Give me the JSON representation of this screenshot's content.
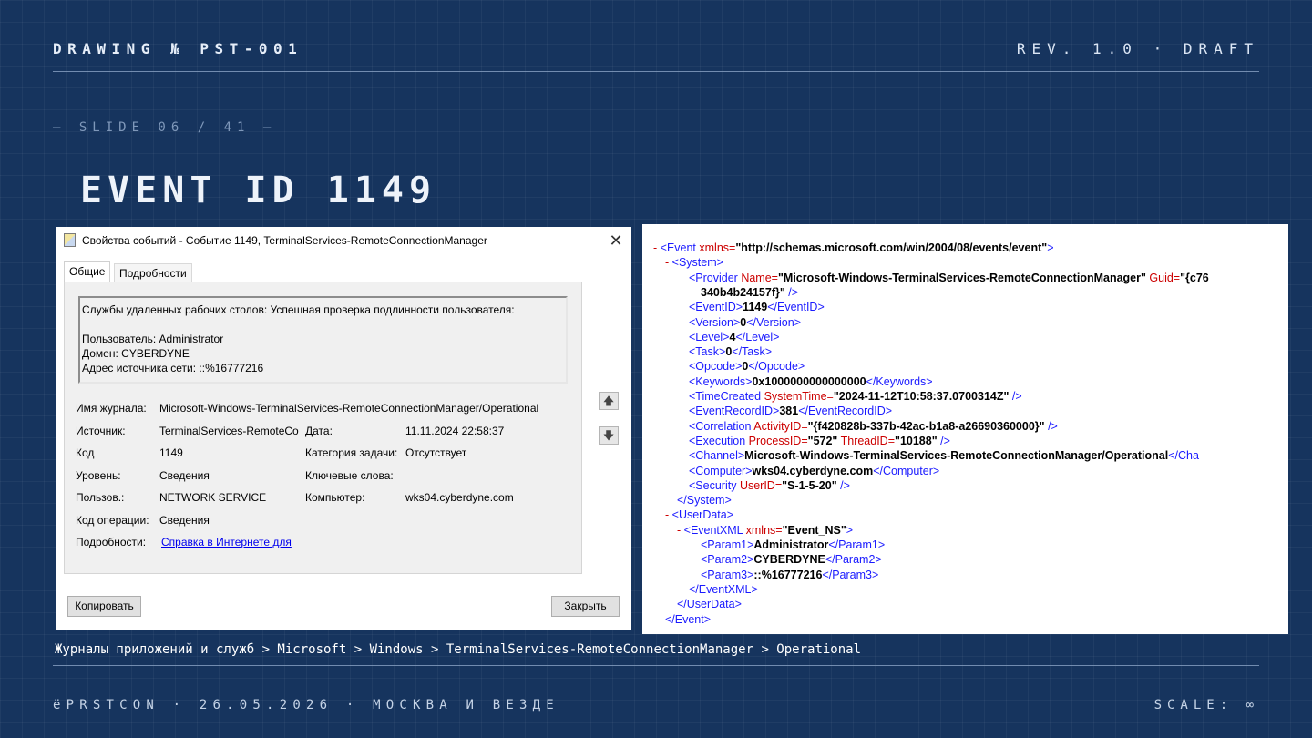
{
  "header": {
    "drawing": "DRAWING № PST-001",
    "revision": "REV. 1.0 · DRAFT"
  },
  "slide_number": "— SLIDE 06 / 41 —",
  "title": "EVENT ID 1149",
  "dialog": {
    "title": "Свойства событий - Событие 1149, TerminalServices-RemoteConnectionManager",
    "close": "✕",
    "tabs": [
      "Общие",
      "Подробности"
    ],
    "description": [
      "Службы удаленных рабочих столов: Успешная проверка подлинности пользователя:",
      "",
      "Пользователь: Administrator",
      "Домен: CYBERDYNE",
      "Адрес источника сети: ::%16777216"
    ],
    "fields": {
      "log_name_label": "Имя журнала:",
      "log_name_value": "Microsoft-Windows-TerminalServices-RemoteConnectionManager/Operational",
      "source_label": "Источник:",
      "source_value": "TerminalServices-RemoteCo",
      "date_label": "Дата:",
      "date_value": "11.11.2024 22:58:37",
      "code_label": "Код",
      "code_value": "1149",
      "task_label": "Категория задачи:",
      "task_value": "Отсутствует",
      "level_label": "Уровень:",
      "level_value": "Сведения",
      "keywords_label": "Ключевые слова:",
      "keywords_value": "",
      "user_label": "Пользов.:",
      "user_value": "NETWORK SERVICE",
      "computer_label": "Компьютер:",
      "computer_value": "wks04.cyberdyne.com",
      "opcode_label": "Код операции:",
      "opcode_value": "Сведения",
      "details_label": "Подробности:",
      "details_link": "Справка в Интернете для"
    },
    "arrows": {
      "up": "🡅",
      "down": "🡇"
    },
    "copy_button": "Копировать",
    "close_button": "Закрыть"
  },
  "xml_lines": [
    {
      "m": "- ",
      "parts": [
        [
          "t",
          "<Event "
        ],
        [
          "a",
          "xmlns="
        ],
        [
          "v",
          "\"http://schemas.microsoft.com/win/2004/08/events/event\""
        ],
        [
          "t",
          ">"
        ]
      ]
    },
    {
      "m": "- ",
      "parts": [
        [
          "t",
          "<System>"
        ]
      ]
    },
    {
      "m": "",
      "parts": [
        [
          "t",
          "<Provider "
        ],
        [
          "a",
          "Name="
        ],
        [
          "v",
          "\"Microsoft-Windows-TerminalServices-RemoteConnectionManager\""
        ],
        [
          "a",
          " Guid="
        ],
        [
          "v",
          "\"{c76"
        ]
      ]
    },
    {
      "m": "",
      "parts": [
        [
          "v",
          "340b4b24157f}\""
        ],
        [
          "t",
          " />"
        ]
      ]
    },
    {
      "m": "",
      "parts": [
        [
          "t",
          "<EventID>"
        ],
        [
          "v",
          "1149"
        ],
        [
          "t",
          "</EventID>"
        ]
      ]
    },
    {
      "m": "",
      "parts": [
        [
          "t",
          "<Version>"
        ],
        [
          "v",
          "0"
        ],
        [
          "t",
          "</Version>"
        ]
      ]
    },
    {
      "m": "",
      "parts": [
        [
          "t",
          "<Level>"
        ],
        [
          "v",
          "4"
        ],
        [
          "t",
          "</Level>"
        ]
      ]
    },
    {
      "m": "",
      "parts": [
        [
          "t",
          "<Task>"
        ],
        [
          "v",
          "0"
        ],
        [
          "t",
          "</Task>"
        ]
      ]
    },
    {
      "m": "",
      "parts": [
        [
          "t",
          "<Opcode>"
        ],
        [
          "v",
          "0"
        ],
        [
          "t",
          "</Opcode>"
        ]
      ]
    },
    {
      "m": "",
      "parts": [
        [
          "t",
          "<Keywords>"
        ],
        [
          "v",
          "0x1000000000000000"
        ],
        [
          "t",
          "</Keywords>"
        ]
      ]
    },
    {
      "m": "",
      "parts": [
        [
          "t",
          "<TimeCreated "
        ],
        [
          "a",
          "SystemTime="
        ],
        [
          "v",
          "\"2024-11-12T10:58:37.0700314Z\""
        ],
        [
          "t",
          " />"
        ]
      ]
    },
    {
      "m": "",
      "parts": [
        [
          "t",
          "<EventRecordID>"
        ],
        [
          "v",
          "381"
        ],
        [
          "t",
          "</EventRecordID>"
        ]
      ]
    },
    {
      "m": "",
      "parts": [
        [
          "t",
          "<Correlation "
        ],
        [
          "a",
          "ActivityID="
        ],
        [
          "v",
          "\"{f420828b-337b-42ac-b1a8-a26690360000}\""
        ],
        [
          "t",
          " />"
        ]
      ]
    },
    {
      "m": "",
      "parts": [
        [
          "t",
          "<Execution "
        ],
        [
          "a",
          "ProcessID="
        ],
        [
          "v",
          "\"572\""
        ],
        [
          "a",
          " ThreadID="
        ],
        [
          "v",
          "\"10188\""
        ],
        [
          "t",
          " />"
        ]
      ]
    },
    {
      "m": "",
      "parts": [
        [
          "t",
          "<Channel>"
        ],
        [
          "v",
          "Microsoft-Windows-TerminalServices-RemoteConnectionManager/Operational"
        ],
        [
          "t",
          "</Cha"
        ]
      ]
    },
    {
      "m": "",
      "parts": [
        [
          "t",
          "<Computer>"
        ],
        [
          "v",
          "wks04.cyberdyne.com"
        ],
        [
          "t",
          "</Computer>"
        ]
      ]
    },
    {
      "m": "",
      "parts": [
        [
          "t",
          "<Security "
        ],
        [
          "a",
          "UserID="
        ],
        [
          "v",
          "\"S-1-5-20\""
        ],
        [
          "t",
          " />"
        ]
      ]
    },
    {
      "m": "",
      "parts": [
        [
          "t",
          "</System>"
        ]
      ]
    },
    {
      "m": "- ",
      "parts": [
        [
          "t",
          "<UserData>"
        ]
      ]
    },
    {
      "m": "- ",
      "parts": [
        [
          "t",
          "<EventXML "
        ],
        [
          "a",
          "xmlns="
        ],
        [
          "v",
          "\"Event_NS\""
        ],
        [
          "t",
          ">"
        ]
      ]
    },
    {
      "m": "",
      "parts": [
        [
          "t",
          "<Param1>"
        ],
        [
          "v",
          "Administrator"
        ],
        [
          "t",
          "</Param1>"
        ]
      ]
    },
    {
      "m": "",
      "parts": [
        [
          "t",
          "<Param2>"
        ],
        [
          "v",
          "CYBERDYNE"
        ],
        [
          "t",
          "</Param2>"
        ]
      ]
    },
    {
      "m": "",
      "parts": [
        [
          "t",
          "<Param3>"
        ],
        [
          "v",
          "::%16777216"
        ],
        [
          "t",
          "</Param3>"
        ]
      ]
    },
    {
      "m": "",
      "parts": [
        [
          "t",
          "</EventXML>"
        ]
      ]
    },
    {
      "m": "",
      "parts": [
        [
          "t",
          "</UserData>"
        ]
      ]
    },
    {
      "m": "",
      "parts": [
        [
          "t",
          "</Event>"
        ]
      ]
    }
  ],
  "breadcrumb": "Журналы приложений и служб > Microsoft > Windows > TerminalServices-RemoteConnectionManager > Operational",
  "footer": {
    "left": "ёPRSTCON · 26.05.2026 · МОСКВА И ВЕЗДЕ",
    "right": "SCALE: ∞"
  }
}
